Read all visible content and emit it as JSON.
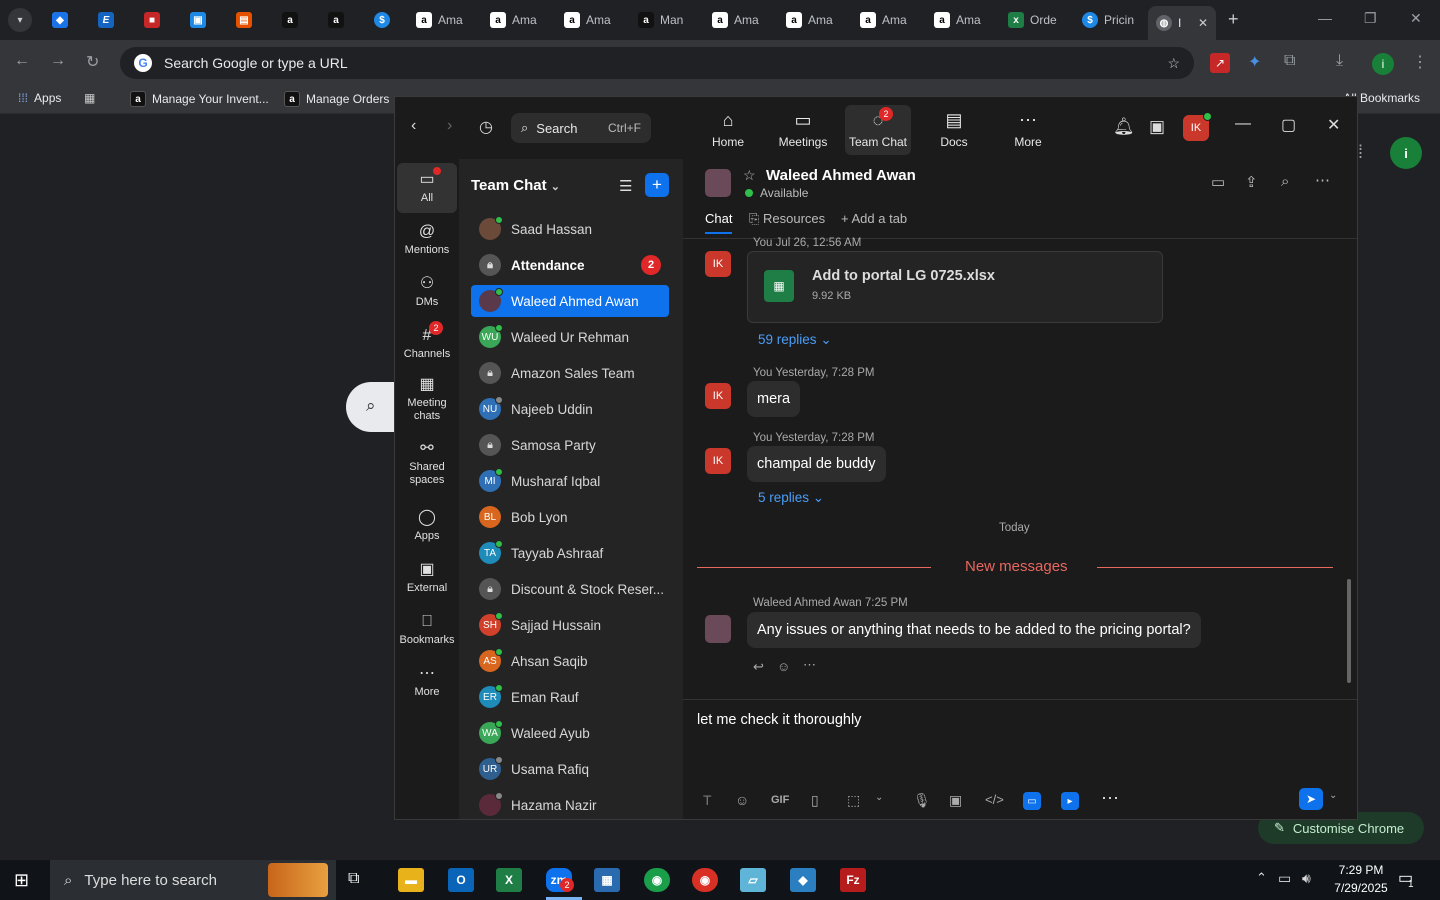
{
  "browser": {
    "tabs": [
      {
        "label": "Ama",
        "icon": "amazon-icon"
      },
      {
        "label": "Ama",
        "icon": "amazon-icon"
      },
      {
        "label": "Ama",
        "icon": "amazon-icon"
      },
      {
        "label": "Man",
        "icon": "amazon-icon"
      },
      {
        "label": "Ama",
        "icon": "amazon-icon"
      },
      {
        "label": "Ama",
        "icon": "amazon-icon"
      },
      {
        "label": "Ama",
        "icon": "amazon-icon"
      },
      {
        "label": "Ama",
        "icon": "amazon-icon"
      },
      {
        "label": "Orde",
        "icon": "excel-icon"
      },
      {
        "label": "Pricin",
        "icon": "pricing-icon"
      },
      {
        "label": "I",
        "icon": "zoom-icon"
      }
    ],
    "omnibox_text": "Search Google or type a URL",
    "bookmarks": {
      "apps": "Apps",
      "items": [
        "Manage Your Invent...",
        "Manage Orders"
      ],
      "all": "All Bookmarks"
    },
    "customise": "Customise Chrome",
    "profile_initial": "i"
  },
  "zoom": {
    "search_label": "Search",
    "search_shortcut": "Ctrl+F",
    "nav": [
      {
        "label": "Home",
        "icon": "home-icon"
      },
      {
        "label": "Meetings",
        "icon": "video-icon"
      },
      {
        "label": "Team Chat",
        "icon": "chat-icon",
        "badge": "2"
      },
      {
        "label": "Docs",
        "icon": "docs-icon"
      },
      {
        "label": "More",
        "icon": "more-icon"
      }
    ],
    "user_initials": "IK",
    "rail": [
      {
        "label": "All",
        "icon": "chat-bubble-icon"
      },
      {
        "label": "Mentions",
        "icon": "at-icon"
      },
      {
        "label": "DMs",
        "icon": "people-icon"
      },
      {
        "label": "Channels",
        "icon": "hash-icon",
        "badge": "2"
      },
      {
        "label": "Meeting chats",
        "icon": "calendar-icon"
      },
      {
        "label": "Shared spaces",
        "icon": "share-icon"
      },
      {
        "label": "Apps",
        "icon": "apps-icon"
      },
      {
        "label": "External",
        "icon": "external-icon"
      },
      {
        "label": "Bookmarks",
        "icon": "bookmark-icon"
      },
      {
        "label": "More",
        "icon": "ellipsis-icon"
      }
    ],
    "list_title": "Team Chat",
    "chats": [
      {
        "name": "Saad Hassan",
        "initials": "",
        "color": "#6b4a3a",
        "status": "online"
      },
      {
        "name": "Attendance",
        "initials": "",
        "color": "lock",
        "badge": "2",
        "bold": true
      },
      {
        "name": "Waleed Ahmed Awan",
        "initials": "",
        "color": "#5a3a4a",
        "status": "online",
        "selected": true
      },
      {
        "name": "Waleed Ur Rehman",
        "initials": "WU",
        "color": "#3aa657",
        "status": "online"
      },
      {
        "name": "Amazon Sales Team",
        "initials": "",
        "color": "lock"
      },
      {
        "name": "Najeeb Uddin",
        "initials": "NU",
        "color": "#2f6fb5",
        "status": "offline"
      },
      {
        "name": "Samosa Party",
        "initials": "",
        "color": "lock"
      },
      {
        "name": "Musharaf Iqbal",
        "initials": "MI",
        "color": "#2f6fb5",
        "status": "online"
      },
      {
        "name": "Bob Lyon",
        "initials": "BL",
        "color": "#d9661f"
      },
      {
        "name": "Tayyab Ashraaf",
        "initials": "TA",
        "color": "#1e8bb8",
        "status": "online"
      },
      {
        "name": "Discount & Stock Reser...",
        "initials": "",
        "color": "lock"
      },
      {
        "name": "Sajjad Hussain",
        "initials": "SH",
        "color": "#d0402a",
        "status": "online"
      },
      {
        "name": "Ahsan Saqib",
        "initials": "AS",
        "color": "#d9661f",
        "status": "online"
      },
      {
        "name": "Eman Rauf",
        "initials": "ER",
        "color": "#1e8bb8",
        "status": "online"
      },
      {
        "name": "Waleed Ayub",
        "initials": "WA",
        "color": "#3aa657",
        "status": "online"
      },
      {
        "name": "Usama Rafiq",
        "initials": "UR",
        "color": "#2f5f8f",
        "status": "offline"
      },
      {
        "name": "Hazama Nazir",
        "initials": "",
        "color": "#5a2a3a",
        "status": "offline"
      }
    ],
    "conversation": {
      "name": "Waleed Ahmed Awan",
      "status": "Available",
      "tabs": [
        "Chat",
        "Resources",
        "Add a tab"
      ],
      "messages": {
        "file_meta": "You Jul 26, 12:56 AM",
        "file_name": "Add to portal LG 0725.xlsx",
        "file_size": "9.92 KB",
        "file_replies": "59 replies",
        "msg1_meta": "You Yesterday, 7:28 PM",
        "msg1_text": "mera",
        "msg2_meta": "You Yesterday, 7:28 PM",
        "msg2_text": "champal de buddy",
        "msg2_replies": "5 replies",
        "today": "Today",
        "new_messages": "New messages",
        "msg3_sender": "Waleed Ahmed Awan",
        "msg3_time": "7:25 PM",
        "msg3_text": "Any issues or anything that needs to be added to the pricing portal?"
      },
      "composer_text": "let me check it thoroughly"
    }
  },
  "taskbar": {
    "search_placeholder": "Type here to search",
    "time": "7:29 PM",
    "date": "7/29/2025",
    "zoom_badge": "2",
    "notif_count": "1"
  }
}
